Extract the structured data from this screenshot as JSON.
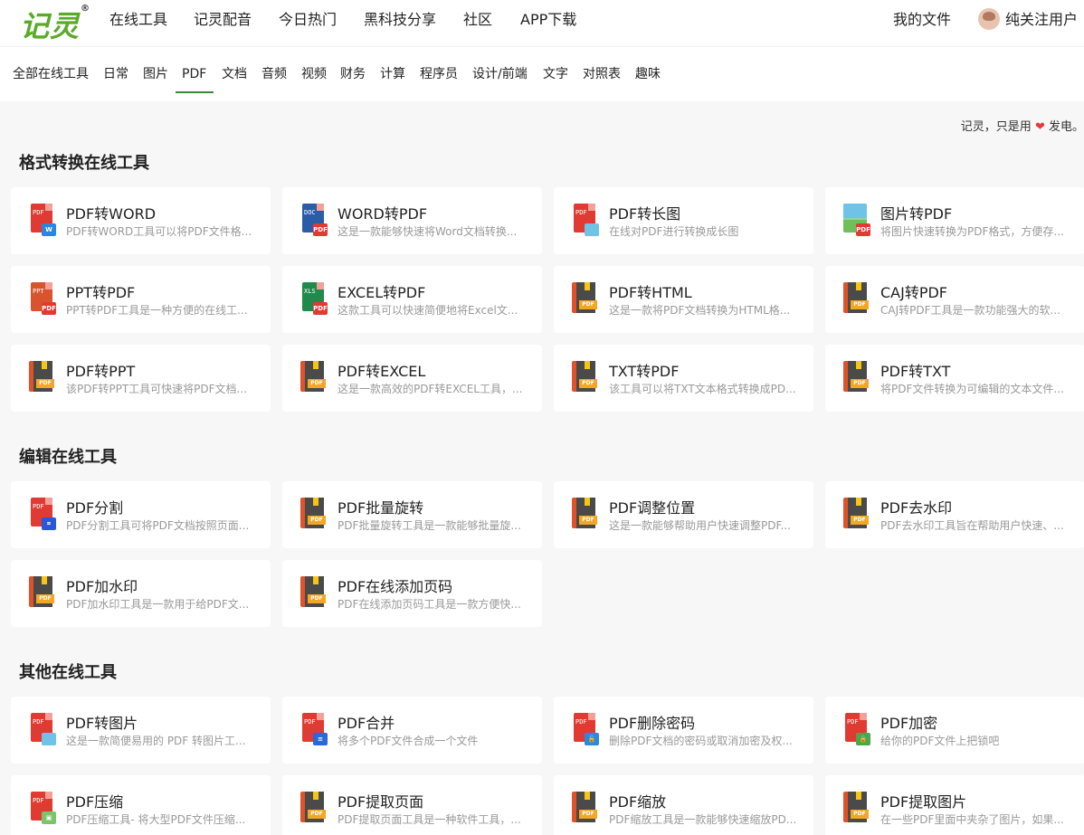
{
  "header": {
    "logo": "记灵",
    "logo_mark": "®",
    "nav": [
      "在线工具",
      "记灵配音",
      "今日热门",
      "黑科技分享",
      "社区",
      "APP下载"
    ],
    "my_files": "我的文件",
    "username": "纯关注用户"
  },
  "categories": {
    "items": [
      "全部在线工具",
      "日常",
      "图片",
      "PDF",
      "文档",
      "音频",
      "视频",
      "财务",
      "计算",
      "程序员",
      "设计/前端",
      "文字",
      "对照表",
      "趣味"
    ],
    "active": "PDF"
  },
  "slogan": {
    "before": "记灵，只是用",
    "heart": "❤",
    "after": "发电。"
  },
  "sections": [
    {
      "title": "格式转换在线工具",
      "cards": [
        {
          "title": "PDF转WORD",
          "desc": "PDF转WORD工具可以将PDF文件格...",
          "icon": "pdf-to-word-icon"
        },
        {
          "title": "WORD转PDF",
          "desc": "这是一款能够快速将Word文档转换...",
          "icon": "word-to-pdf-icon"
        },
        {
          "title": "PDF转长图",
          "desc": "在线对PDF进行转换成长图",
          "icon": "pdf-to-image-icon"
        },
        {
          "title": "图片转PDF",
          "desc": "将图片快速转换为PDF格式，方便存...",
          "icon": "image-to-pdf-icon"
        },
        {
          "title": "PPT转PDF",
          "desc": "PPT转PDF工具是一种方便的在线工...",
          "icon": "ppt-to-pdf-icon"
        },
        {
          "title": "EXCEL转PDF",
          "desc": "这款工具可以快速简便地将Excel文...",
          "icon": "excel-to-pdf-icon"
        },
        {
          "title": "PDF转HTML",
          "desc": "这是一款将PDF文档转换为HTML格...",
          "icon": "pdf-book-icon"
        },
        {
          "title": "CAJ转PDF",
          "desc": "CAJ转PDF工具是一款功能强大的软...",
          "icon": "pdf-book-icon"
        },
        {
          "title": "PDF转PPT",
          "desc": "该PDF转PPT工具可快速将PDF文档...",
          "icon": "pdf-book-icon"
        },
        {
          "title": "PDF转EXCEL",
          "desc": "这是一款高效的PDF转EXCEL工具，...",
          "icon": "pdf-book-icon"
        },
        {
          "title": "TXT转PDF",
          "desc": "该工具可以将TXT文本格式转换成PD...",
          "icon": "pdf-book-icon"
        },
        {
          "title": "PDF转TXT",
          "desc": "将PDF文件转换为可编辑的文本文件...",
          "icon": "pdf-book-icon"
        }
      ]
    },
    {
      "title": "编辑在线工具",
      "cards": [
        {
          "title": "PDF分割",
          "desc": "PDF分割工具可将PDF文档按照页面...",
          "icon": "pdf-split-icon"
        },
        {
          "title": "PDF批量旋转",
          "desc": "PDF批量旋转工具是一款能够批量旋...",
          "icon": "pdf-book-icon"
        },
        {
          "title": "PDF调整位置",
          "desc": "这是一款能够帮助用户快速调整PDF...",
          "icon": "pdf-book-icon"
        },
        {
          "title": "PDF去水印",
          "desc": "PDF去水印工具旨在帮助用户快速、...",
          "icon": "pdf-book-icon"
        },
        {
          "title": "PDF加水印",
          "desc": "PDF加水印工具是一款用于给PDF文...",
          "icon": "pdf-book-icon"
        },
        {
          "title": "PDF在线添加页码",
          "desc": "PDF在线添加页码工具是一款方便快...",
          "icon": "pdf-book-icon"
        }
      ]
    },
    {
      "title": "其他在线工具",
      "cards": [
        {
          "title": "PDF转图片",
          "desc": "这是一款简便易用的 PDF 转图片工...",
          "icon": "pdf-to-image-icon"
        },
        {
          "title": "PDF合并",
          "desc": "将多个PDF文件合成一个文件",
          "icon": "pdf-merge-icon"
        },
        {
          "title": "PDF删除密码",
          "desc": "删除PDF文档的密码或取消加密及权...",
          "icon": "pdf-unlock-icon"
        },
        {
          "title": "PDF加密",
          "desc": "给你的PDF文件上把锁吧",
          "icon": "pdf-lock-icon"
        },
        {
          "title": "PDF压缩",
          "desc": "PDF压缩工具- 将大型PDF文件压缩...",
          "icon": "pdf-compress-icon"
        },
        {
          "title": "PDF提取页面",
          "desc": "PDF提取页面工具是一种软件工具，...",
          "icon": "pdf-book-icon"
        },
        {
          "title": "PDF缩放",
          "desc": "PDF缩放工具是一款能够快速缩放PD...",
          "icon": "pdf-book-icon"
        },
        {
          "title": "PDF提取图片",
          "desc": "在一些PDF里面中夹杂了图片，如果...",
          "icon": "pdf-book-icon"
        }
      ]
    }
  ],
  "colors": {
    "brand_green": "#5aaa2a",
    "active_underline": "#3a8a3a",
    "heart_red": "#e23b3b",
    "pdf_red": "#e03a32",
    "book_orange": "#e0522a",
    "book_tag": "#f5a623"
  },
  "icon_badges": {
    "pdf-to-word-icon": {
      "doc_label": "PDF",
      "badge_label": "W",
      "doc_color": "#e03a32",
      "badge_color": "#2a86e0"
    },
    "word-to-pdf-icon": {
      "doc_label": "DOC",
      "badge_label": "PDF",
      "doc_color": "#2a5ca8",
      "badge_color": "#e03a32"
    },
    "ppt-to-pdf-icon": {
      "doc_label": "PPT",
      "badge_label": "PDF",
      "doc_color": "#d9532c",
      "badge_color": "#e03a32"
    },
    "excel-to-pdf-icon": {
      "doc_label": "XLS",
      "badge_label": "PDF",
      "doc_color": "#1f8a4c",
      "badge_color": "#e03a32"
    },
    "pdf-split-icon": {
      "doc_label": "PDF",
      "badge_label": "⌗",
      "doc_color": "#e03a32",
      "badge_color": "#2a56d8"
    },
    "pdf-merge-icon": {
      "doc_label": "PDF",
      "badge_label": "≡",
      "doc_color": "#e03a32",
      "badge_color": "#2a6ad8"
    },
    "pdf-unlock-icon": {
      "doc_label": "PDF",
      "badge_label": "🔓",
      "doc_color": "#e03a32",
      "badge_color": "#2a8ae0"
    },
    "pdf-lock-icon": {
      "doc_label": "PDF",
      "badge_label": "🔒",
      "doc_color": "#e03a32",
      "badge_color": "#4aa84a"
    },
    "pdf-compress-icon": {
      "doc_label": "PDF",
      "badge_label": "▣",
      "doc_color": "#e03a32",
      "badge_color": "#7bc46a"
    },
    "pdf-book-tag": "PDF"
  }
}
